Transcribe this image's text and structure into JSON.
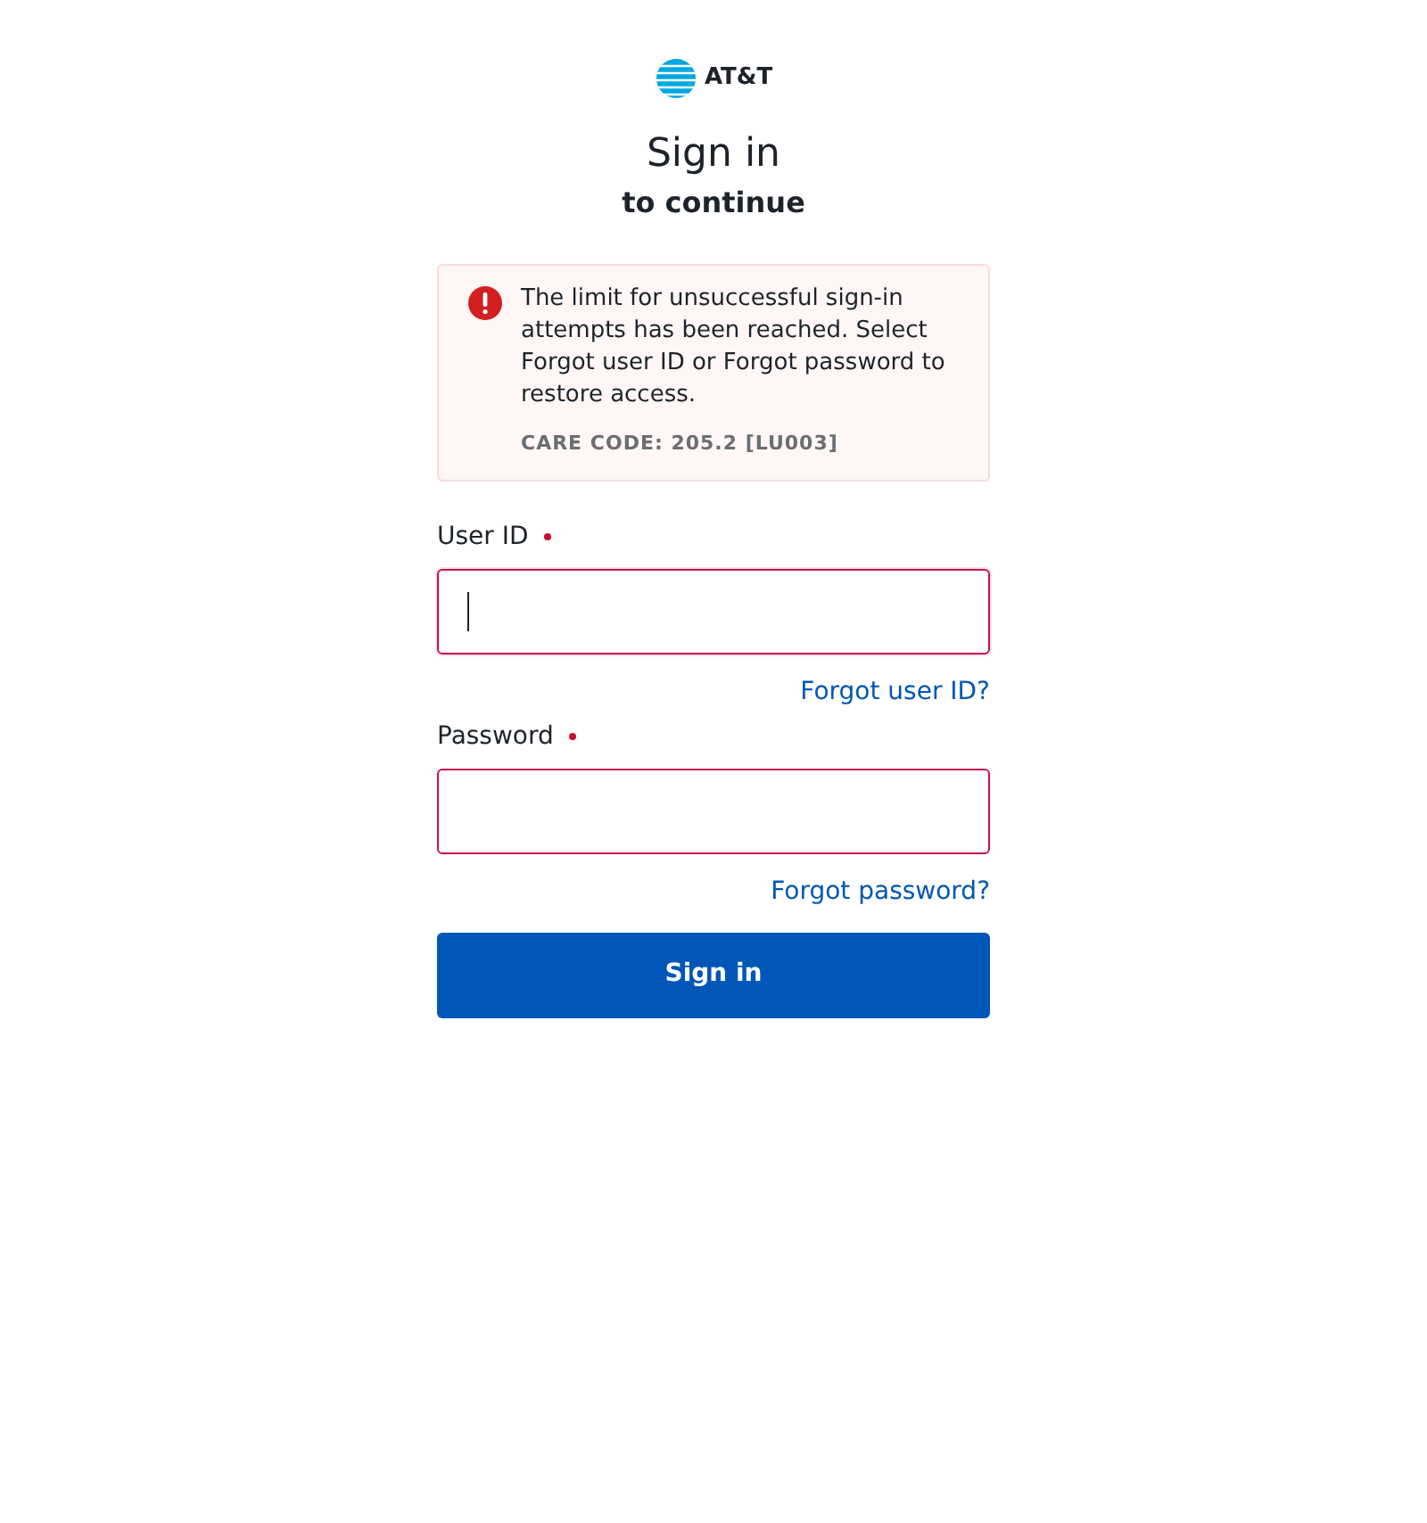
{
  "logo": {
    "text": "AT&T"
  },
  "heading": {
    "title": "Sign in",
    "subtitle": "to continue"
  },
  "alert": {
    "kind": "error",
    "message": "The limit for unsuccessful sign-in attempts has been reached. Select Forgot user ID or Forgot password to restore access.",
    "care_code": "CARE CODE: 205.2 [LU003]"
  },
  "fields": [
    {
      "label": "User ID",
      "required": true,
      "invalid": true,
      "focused": true,
      "link": "Forgot user ID?"
    },
    {
      "label": "Password",
      "required": true,
      "invalid": true,
      "focused": false,
      "link": "Forgot password?"
    }
  ],
  "submit": {
    "label": "Sign in"
  }
}
